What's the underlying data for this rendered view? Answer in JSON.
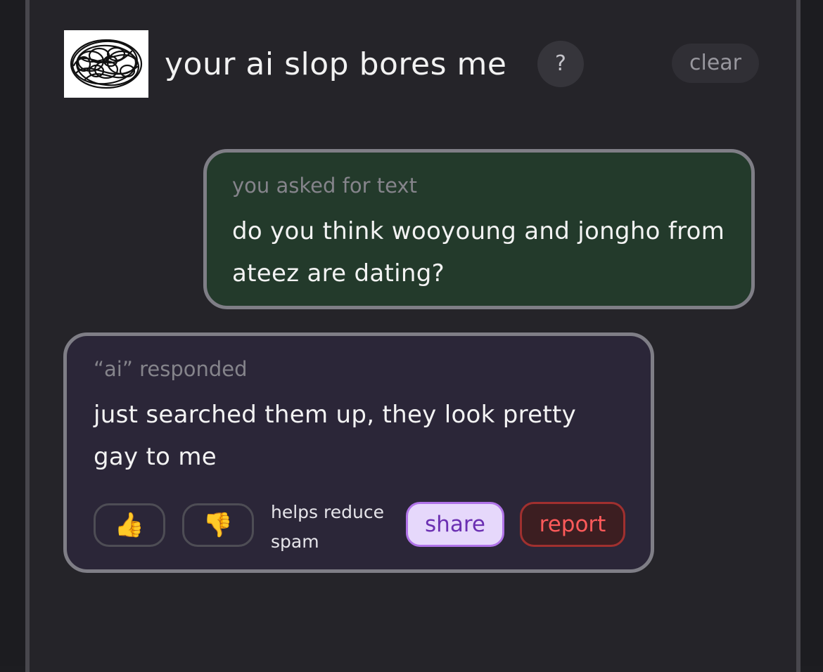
{
  "header": {
    "title": "your ai slop bores me",
    "help_label": "?",
    "clear_label": "clear",
    "logo_icon": "scribble-logo-icon"
  },
  "user_message": {
    "caption": "you asked for text",
    "text": "do you think wooyoung and jongho from ateez are dating?"
  },
  "ai_message": {
    "caption": "“ai” responded",
    "text": "just searched them up, they look pretty gay to me",
    "actions": {
      "thumbs_up": "👍",
      "thumbs_down": "👎",
      "helps_text": "helps reduce spam",
      "share_label": "share",
      "report_label": "report"
    }
  },
  "colors": {
    "user_bubble_bg": "#233a2b",
    "ai_bubble_bg": "#2b2638",
    "share_bg": "#e6d8fb",
    "report_text": "#ff5a5a"
  }
}
